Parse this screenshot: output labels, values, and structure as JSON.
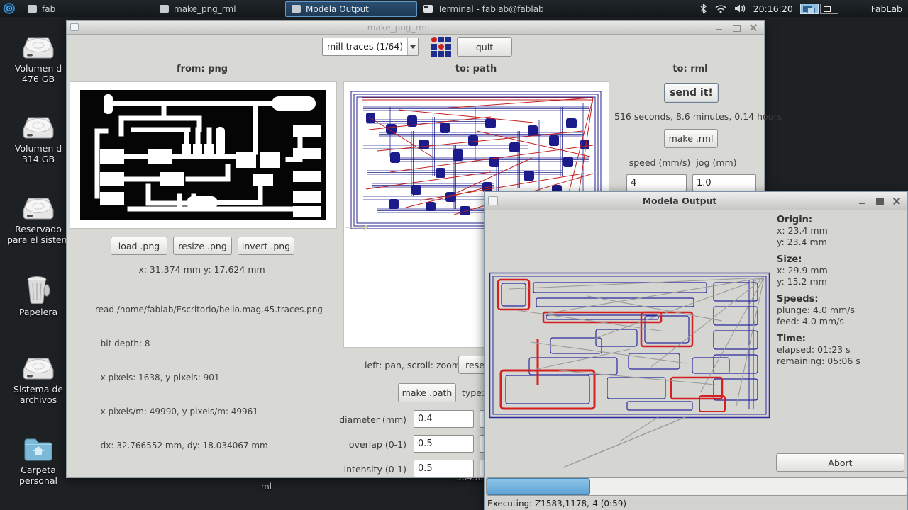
{
  "taskbar": {
    "clock": "20:16:20",
    "host_label": "FabLab",
    "windows": [
      {
        "label": "fab"
      },
      {
        "label": "make_png_rml"
      },
      {
        "label": "Modela Output"
      },
      {
        "label": "Terminal - fablab@fablab-..."
      }
    ]
  },
  "desktop": {
    "icons": [
      {
        "type": "drive",
        "line1": "Volumen d",
        "line2": "476 GB"
      },
      {
        "type": "drive",
        "line1": "Volumen d",
        "line2": "314 GB"
      },
      {
        "type": "drive",
        "line1": "Reservado",
        "line2": "para el sistem"
      },
      {
        "type": "trash",
        "line1": "Papelera",
        "line2": ""
      },
      {
        "type": "drive",
        "line1": "Sistema de",
        "line2": "archivos"
      },
      {
        "type": "folder",
        "line1": "Carpeta",
        "line2": "personal"
      }
    ],
    "fragments": {
      "frag1": "ml",
      "frag2": "56436"
    }
  },
  "fab_window": {
    "title": "make_png_rml",
    "toolbar": {
      "process_select": "mill traces (1/64)",
      "quit_label": "quit"
    },
    "columns": {
      "from_png": "from: png",
      "to_path": "to: path",
      "to_rml": "to: rml"
    },
    "png_panel": {
      "buttons": [
        "load .png",
        "resize .png",
        "invert .png"
      ],
      "coords": "x: 31.374 mm  y: 17.624 mm",
      "info": [
        "read /home/fablab/Escritorio/hello.mag.45.traces.png",
        "  bit depth: 8",
        "  x pixels: 1638, y pixels: 901",
        "  x pixels/m: 49990, y pixels/m: 49961",
        "  dx: 32.766552 mm, dy: 18.034067 mm"
      ]
    },
    "path_panel": {
      "hint": "left: pan, scroll: zoom",
      "reset_label": "reset",
      "make_path_label": "make .path",
      "type_label": "type:",
      "params": [
        {
          "label": "diameter (mm)",
          "value": "0.4"
        },
        {
          "label": "overlap (0-1)",
          "value": "0.5"
        },
        {
          "label": "intensity (0-1)",
          "value": "0.5"
        }
      ]
    },
    "rml_panel": {
      "send_label": "send it!",
      "time_estimate": "516 seconds, 8.6 minutes, 0.14 hours",
      "make_rml_label": "make .rml",
      "speed_label": "speed (mm/s)",
      "jog_label": "jog (mm)",
      "speed_value": "4",
      "jog_value": "1.0"
    }
  },
  "modela_window": {
    "title": "Modela Output",
    "info": {
      "origin_header": "Origin:",
      "origin_x": "x: 23.4 mm",
      "origin_y": "y: 23.4 mm",
      "size_header": "Size:",
      "size_x": "x: 29.9 mm",
      "size_y": "y: 15.2 mm",
      "speeds_header": "Speeds:",
      "plunge": "plunge: 4.0 mm/s",
      "feed": "feed: 4.0 mm/s",
      "time_header": "Time:",
      "elapsed": "elapsed: 01:23 s",
      "remaining": "remaining: 05:06 s"
    },
    "abort_label": "Abort",
    "progress_percent": 24.7,
    "status": "Executing: Z1583,1178,-4 (0:59)"
  },
  "icons": {
    "app-logo-icon": "blue concentric circles",
    "window-icon": "light gray window square",
    "terminal-icon": "terminal window",
    "bluetooth-icon": "bluetooth rune",
    "wifi-icon": "wifi arcs",
    "volume-icon": "speaker with waves",
    "workspace-switcher": "two desktop panes",
    "drive-icon": "hard disk",
    "trash-icon": "waste basket",
    "folder-icon": "blue home folder",
    "fab-modules-icon": "3x3 grid of blue squares and red dots",
    "dropdown-arrow-icon": "triangle down",
    "origin-arrow-icon": "pale yellow right arrow"
  },
  "colors": {
    "accent": "#5e97c9",
    "taskbar_bg": "#15191b",
    "desktop_bg": "#1d2123",
    "window_bg": "#d8d8d5",
    "toolpath_blue": "#1b1b8c",
    "toolpath_red": "#c32020",
    "jog_gray": "#9b9b9b",
    "progress_fill": "#5ea2d4"
  }
}
